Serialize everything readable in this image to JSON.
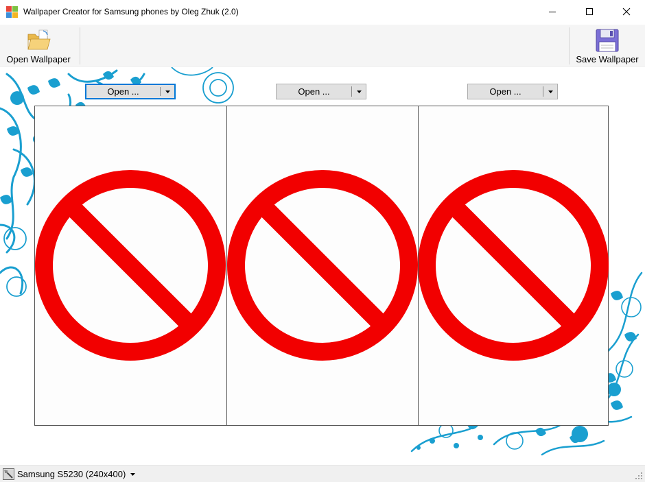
{
  "window": {
    "title": "Wallpaper Creator for Samsung phones by Oleg Zhuk (2.0)",
    "app_icon": "colored-squares-icon",
    "controls": [
      "minimize-icon",
      "maximize-icon",
      "close-icon"
    ]
  },
  "toolbar": {
    "open_label": "Open Wallpaper",
    "open_icon": "folder-open-icon",
    "save_label": "Save Wallpaper",
    "save_icon": "floppy-disk-icon"
  },
  "frames": [
    {
      "button_label": "Open ...",
      "focused": true,
      "placeholder_icon": "prohibited-sign-icon"
    },
    {
      "button_label": "Open ...",
      "focused": false,
      "placeholder_icon": "prohibited-sign-icon"
    },
    {
      "button_label": "Open ...",
      "focused": false,
      "placeholder_icon": "prohibited-sign-icon"
    }
  ],
  "status": {
    "device_label": "Samsung S5230 (240x400)",
    "device_icon": "phone-icon"
  },
  "colors": {
    "prohibited_red": "#f20000",
    "deco_blue": "#1a9fd0",
    "focus_blue": "#0078d7",
    "toolbar_bg": "#f5f5f5"
  }
}
